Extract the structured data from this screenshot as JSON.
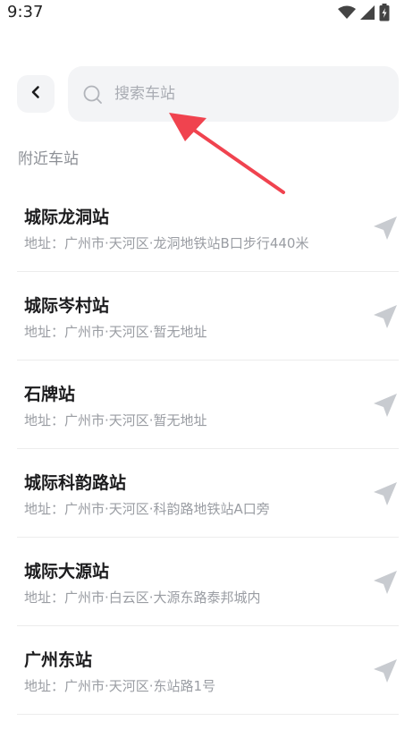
{
  "status_bar": {
    "time": "9:37",
    "icons": [
      "wifi-icon",
      "signal-icon",
      "battery-charging-icon"
    ]
  },
  "header": {
    "back_icon": "chevron-left-icon",
    "search": {
      "icon": "search-icon",
      "placeholder": "搜索车站"
    }
  },
  "annotation": {
    "icon": "red-arrow-pointer"
  },
  "nearby": {
    "title": "附近车站",
    "stations": [
      {
        "name": "城际龙洞站",
        "address": "地址：广州市·天河区·龙洞地铁站B口步行440米"
      },
      {
        "name": "城际岑村站",
        "address": "地址：广州市·天河区·暂无地址"
      },
      {
        "name": "石牌站",
        "address": "地址：广州市·天河区·暂无地址"
      },
      {
        "name": "城际科韵路站",
        "address": "地址：广州市·天河区·科韵路地铁站A口旁"
      },
      {
        "name": "城际大源站",
        "address": "地址：广州市·白云区·大源东路泰邦城内"
      },
      {
        "name": "广州东站",
        "address": "地址：广州市·天河区·东站路1号"
      }
    ]
  },
  "colors": {
    "annotation_red": "#f0434f",
    "nav_icon": "#c8cbd0",
    "search_bg": "#f3f4f6"
  }
}
